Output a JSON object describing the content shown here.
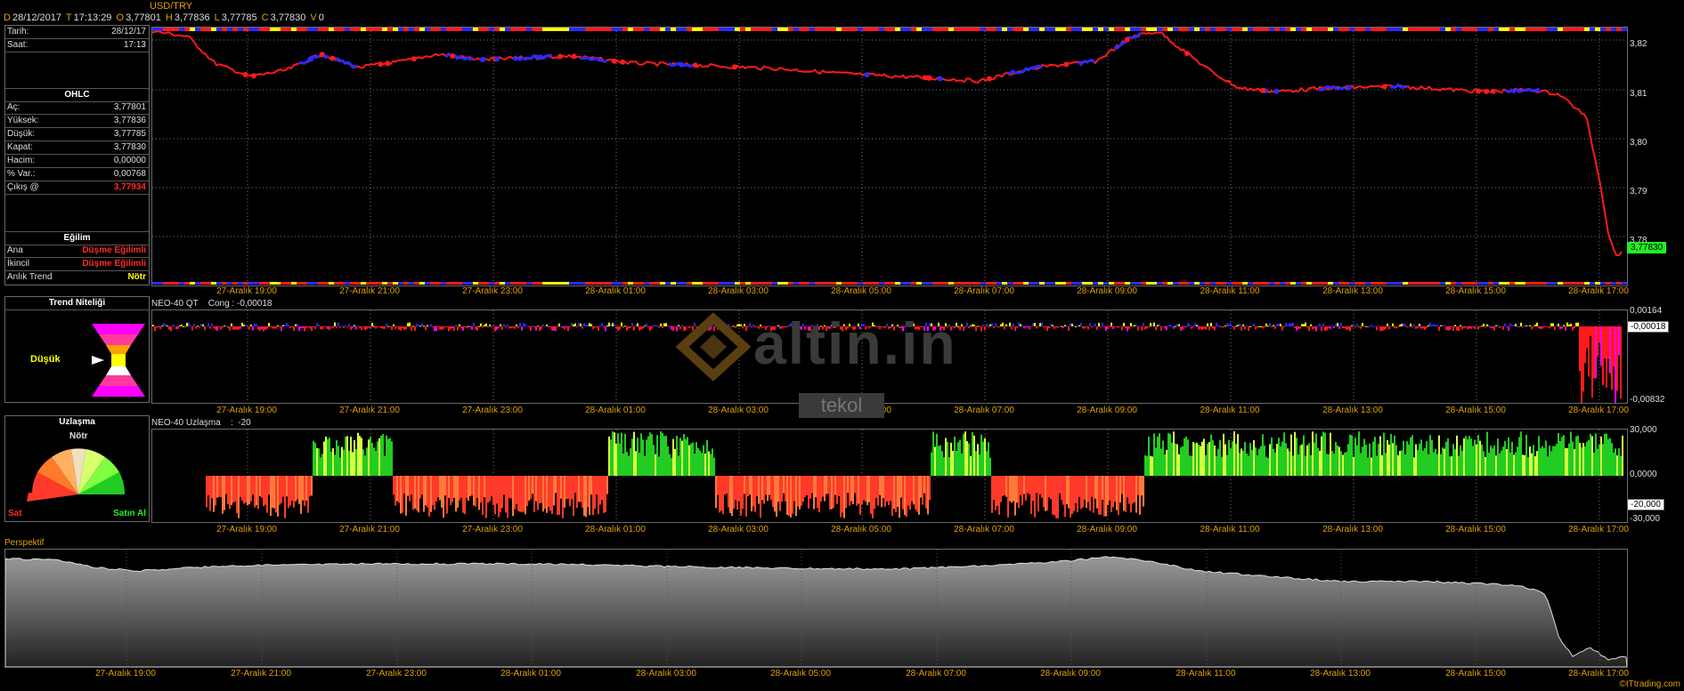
{
  "topbar": {
    "date_key": "D",
    "date": "28/12/2017",
    "time_key": "T",
    "time": "17:13:29",
    "open_key": "O",
    "open": "3,77801",
    "high_key": "H",
    "high": "3,77836",
    "low_key": "L",
    "low": "3,77785",
    "close_key": "C",
    "close": "3,77830",
    "vol_key": "V",
    "vol": "0"
  },
  "symbol": "USD/TRY",
  "info": {
    "date_label": "Tarih:",
    "date_value": "28/12/17",
    "time_label": "Saat:",
    "time_value": "17:13",
    "ohlc_title": "OHLC",
    "open_label": "Aç:",
    "open_value": "3,77801",
    "high_label": "Yüksek:",
    "high_value": "3,77836",
    "low_label": "Düşük:",
    "low_value": "3,77785",
    "close_label": "Kapat:",
    "close_value": "3,77830",
    "volume_label": "Hacim:",
    "volume_value": "0,00000",
    "pct_label": "% Var.:",
    "pct_value": "0,00768",
    "exit_label": "Çıkış @",
    "exit_value": "3,77934",
    "trend_title": "Eğilim",
    "main_label": "Ana",
    "main_value": "Düşme Eğilimli",
    "second_label": "İkincil",
    "second_value": "Düşme Eğilimli",
    "instant_label": "Anlık Trend",
    "instant_value": "Nötr"
  },
  "trend_quality": {
    "title": "Trend Niteliği",
    "value": "Düşük"
  },
  "consensus": {
    "title": "Uzlaşma",
    "neutral": "Nötr",
    "sell": "Sat",
    "buy": "Satın Al"
  },
  "price_panel": {
    "y_ticks": [
      "3,82",
      "3,81",
      "3,80",
      "3,79",
      "3,78"
    ],
    "last_price": "3,77830"
  },
  "qt_panel": {
    "title": "NEO-40 QT",
    "cong_label": "Cong :",
    "cong_value": "-0,00018",
    "y_top": "0,00164",
    "y_bottom": "-0,00832",
    "current": "-0,00018"
  },
  "uz_panel": {
    "title": "NEO-40 Uzlaşma",
    "sep": ":",
    "value": "-20",
    "y_top": "30,000",
    "y_mid": "0,0000",
    "y_bottom": "-30,000",
    "current": "-20,000"
  },
  "persp_panel": {
    "title": "Perspektif"
  },
  "x_labels": [
    "27-Aralık 19:00",
    "27-Aralık 21:00",
    "27-Aralık 23:00",
    "28-Aralık 01:00",
    "28-Aralık 03:00",
    "28-Aralık 05:00",
    "28-Aralık 07:00",
    "28-Aralık 09:00",
    "28-Aralık 11:00",
    "28-Aralık 13:00",
    "28-Aralık 15:00",
    "28-Aralık 17:00"
  ],
  "watermark": {
    "brand": "altin.in",
    "sub": "tekol"
  },
  "credit": "©ITtrading.com",
  "colors": {
    "up": "#2a2aff",
    "down": "#ff1a1a",
    "accent": "#e0a000",
    "green": "#22dd22",
    "yellow": "#ffff00"
  }
}
